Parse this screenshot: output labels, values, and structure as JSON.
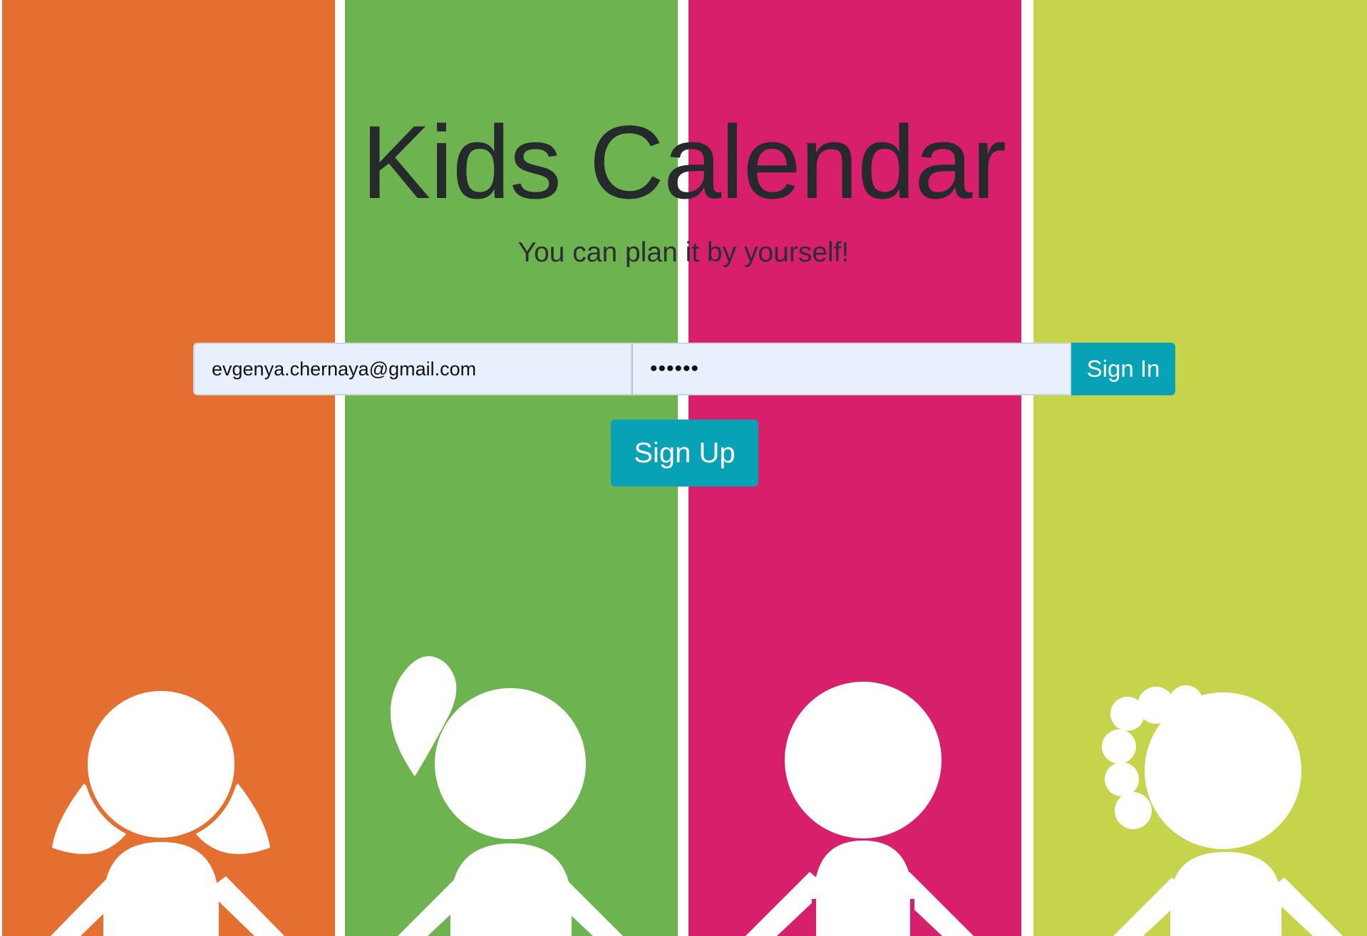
{
  "app": {
    "title": "Kids Calendar",
    "subtitle": "You can plan it by yourself!"
  },
  "login_form": {
    "email_value": "evgenya.chernaya@gmail.com",
    "password_value": "••••••",
    "sign_in_label": "Sign In",
    "sign_up_label": "Sign Up"
  },
  "background": {
    "stripes": [
      {
        "color": "#e56f31",
        "figure": "girl-with-pigtails"
      },
      {
        "color": "#6db34f",
        "figure": "girl-with-ponytail"
      },
      {
        "color": "#d81f6b",
        "figure": "boy"
      },
      {
        "color": "#c5d44a",
        "figure": "girl-with-curls"
      }
    ],
    "divider_color": "#ffffff"
  },
  "colors": {
    "accent": "#07a2b6",
    "input_background": "#e7f0fc",
    "title_text": "#262a2d"
  }
}
